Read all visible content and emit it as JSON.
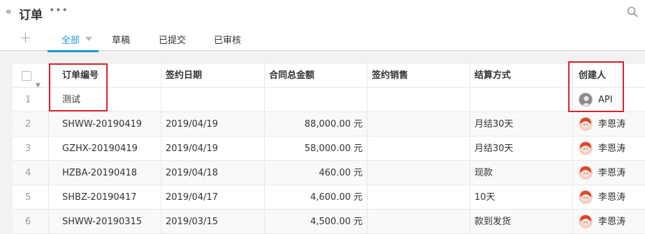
{
  "header": {
    "back_glyph": "«",
    "title": "订单",
    "more_glyph": "•••"
  },
  "tabs": {
    "add_glyph": "+",
    "items": [
      {
        "label": "全部"
      },
      {
        "label": "草稿"
      },
      {
        "label": "已提交"
      },
      {
        "label": "已审核"
      }
    ]
  },
  "table": {
    "columns": [
      "订单编号",
      "签约日期",
      "合同总金额",
      "签约销售",
      "结算方式",
      "创建人"
    ],
    "rows": [
      {
        "no": "1",
        "order": "测试",
        "date": "",
        "amount": "",
        "sales": "",
        "settle": "",
        "creator": "API"
      },
      {
        "no": "2",
        "order": "SHWW-20190419",
        "date": "2019/04/19",
        "amount": "88,000.00 元",
        "sales": "",
        "settle": "月结30天",
        "creator": "李恩涛"
      },
      {
        "no": "3",
        "order": "GZHX-20190419",
        "date": "2019/04/19",
        "amount": "58,000.00 元",
        "sales": "",
        "settle": "月结30天",
        "creator": "李恩涛"
      },
      {
        "no": "4",
        "order": "HZBA-20190418",
        "date": "2019/04/18",
        "amount": "460.00 元",
        "sales": "",
        "settle": "现款",
        "creator": "李恩涛"
      },
      {
        "no": "5",
        "order": "SHBZ-20190417",
        "date": "2019/04/17",
        "amount": "4,600.00 元",
        "sales": "",
        "settle": "10天",
        "creator": "李恩涛"
      },
      {
        "no": "6",
        "order": "SHWW-20190315",
        "date": "2019/03/15",
        "amount": "4,500.00 元",
        "sales": "",
        "settle": "款到发货",
        "creator": "李恩涛"
      }
    ]
  },
  "colors": {
    "accent": "#1e96d7",
    "highlight": "#d9232e"
  }
}
